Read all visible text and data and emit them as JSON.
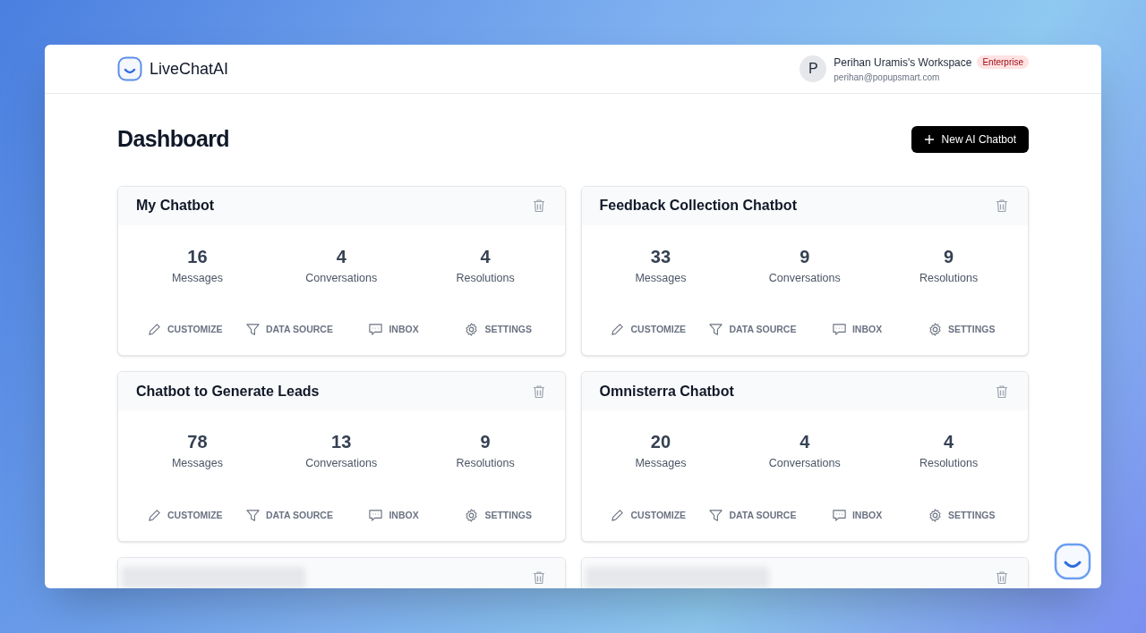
{
  "header": {
    "logo_text": "LiveChatAI",
    "workspace": {
      "avatar_letter": "P",
      "name": "Perihan Uramis's Workspace",
      "plan": "Enterprise",
      "email": "perihan@popupsmart.com"
    }
  },
  "page": {
    "title": "Dashboard",
    "new_button": "New AI Chatbot"
  },
  "cards": [
    {
      "title": "My Chatbot",
      "redacted": false,
      "stats": [
        {
          "value": "16",
          "label": "Messages"
        },
        {
          "value": "4",
          "label": "Conversations"
        },
        {
          "value": "4",
          "label": "Resolutions"
        }
      ],
      "actions": [
        {
          "kind": "pencil",
          "label": "CUSTOMIZE"
        },
        {
          "kind": "filter",
          "label": "DATA SOURCE"
        },
        {
          "kind": "chat",
          "label": "INBOX"
        },
        {
          "kind": "gear",
          "label": "SETTINGS"
        }
      ]
    },
    {
      "title": "Feedback Collection Chatbot",
      "redacted": false,
      "stats": [
        {
          "value": "33",
          "label": "Messages"
        },
        {
          "value": "9",
          "label": "Conversations"
        },
        {
          "value": "9",
          "label": "Resolutions"
        }
      ],
      "actions": [
        {
          "kind": "pencil",
          "label": "CUSTOMIZE"
        },
        {
          "kind": "filter",
          "label": "DATA SOURCE"
        },
        {
          "kind": "chat",
          "label": "INBOX"
        },
        {
          "kind": "gear",
          "label": "SETTINGS"
        }
      ]
    },
    {
      "title": "Chatbot to Generate Leads",
      "redacted": false,
      "stats": [
        {
          "value": "78",
          "label": "Messages"
        },
        {
          "value": "13",
          "label": "Conversations"
        },
        {
          "value": "9",
          "label": "Resolutions"
        }
      ],
      "actions": [
        {
          "kind": "pencil",
          "label": "CUSTOMIZE"
        },
        {
          "kind": "filter",
          "label": "DATA SOURCE"
        },
        {
          "kind": "chat",
          "label": "INBOX"
        },
        {
          "kind": "gear",
          "label": "SETTINGS"
        }
      ]
    },
    {
      "title": "Omnisterra Chatbot",
      "redacted": false,
      "stats": [
        {
          "value": "20",
          "label": "Messages"
        },
        {
          "value": "4",
          "label": "Conversations"
        },
        {
          "value": "4",
          "label": "Resolutions"
        }
      ],
      "actions": [
        {
          "kind": "pencil",
          "label": "CUSTOMIZE"
        },
        {
          "kind": "filter",
          "label": "DATA SOURCE"
        },
        {
          "kind": "chat",
          "label": "INBOX"
        },
        {
          "kind": "gear",
          "label": "SETTINGS"
        }
      ]
    },
    {
      "redacted": true
    },
    {
      "redacted": true
    }
  ]
}
